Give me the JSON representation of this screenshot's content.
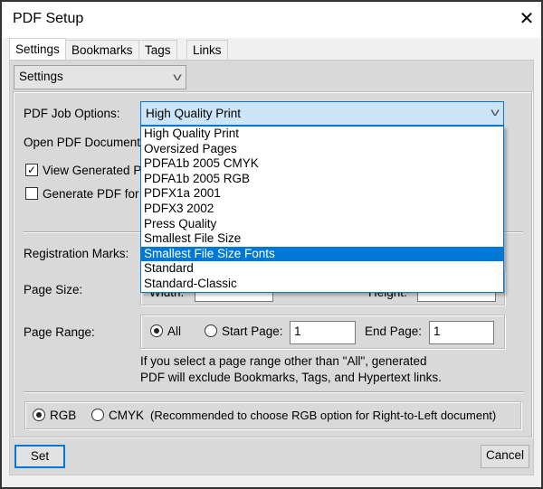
{
  "window": {
    "title": "PDF Setup",
    "close_icon": "close-icon"
  },
  "tabs": [
    {
      "label": "Settings",
      "active": true
    },
    {
      "label": "Bookmarks"
    },
    {
      "label": "Tags"
    },
    {
      "label": "Links"
    }
  ],
  "section_select": {
    "value": "Settings"
  },
  "job_options": {
    "label": "PDF Job Options:",
    "value": "High Quality Print",
    "options": [
      "High Quality Print",
      "Oversized Pages",
      "PDFA1b 2005 CMYK",
      "PDFA1b 2005 RGB",
      "PDFX1a 2001",
      "PDFX3 2002",
      "Press Quality",
      "Smallest File Size",
      "Smallest File Size Fonts",
      "Standard",
      "Standard-Classic"
    ],
    "highlighted": "Smallest File Size Fonts"
  },
  "open_pdf_label": "Open PDF Document",
  "view_generated": {
    "label": "View Generated P",
    "checked": true
  },
  "generate_pdf_for": {
    "label": "Generate PDF for",
    "checked": false
  },
  "registration_marks_label": "Registration Marks:",
  "page_size": {
    "label": "Page Size:",
    "width_label": "Width:",
    "height_label": "Height:"
  },
  "page_range": {
    "label": "Page Range:",
    "all_label": "All",
    "all_selected": true,
    "start_label": "Start Page:",
    "start_value": "1",
    "end_label": "End Page:",
    "end_value": "1",
    "note_line1": "If you select a page range other than \"All\",  generated",
    "note_line2": "PDF will exclude Bookmarks, Tags, and Hypertext links."
  },
  "color": {
    "rgb_label": "RGB",
    "rgb_selected": true,
    "cmyk_label": "CMYK",
    "note": "(Recommended to choose RGB option for Right-to-Left document)"
  },
  "buttons": {
    "set": "Set",
    "cancel": "Cancel"
  }
}
